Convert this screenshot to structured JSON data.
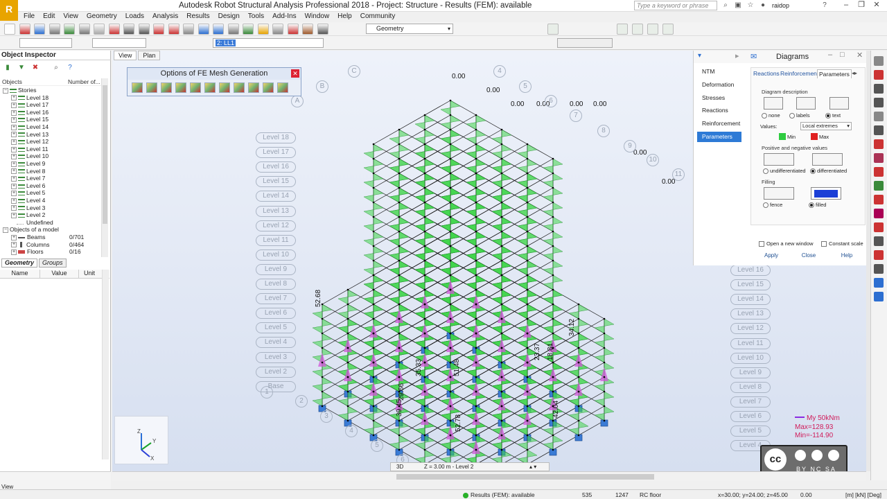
{
  "app": {
    "title": "Autodesk Robot Structural Analysis Professional 2018 - Project: Structure - Results (FEM): available",
    "logo_text": "R",
    "search_placeholder": "Type a keyword or phrase",
    "user": "raidop"
  },
  "menu": [
    "File",
    "Edit",
    "View",
    "Geometry",
    "Loads",
    "Analysis",
    "Results",
    "Design",
    "Tools",
    "Add-Ins",
    "Window",
    "Help",
    "Community"
  ],
  "toolbar": {
    "layout_select": "Geometry",
    "case_combo": "2: LL1"
  },
  "inspector": {
    "title": "Object Inspector",
    "col_objects": "Objects",
    "col_number": "Number of...",
    "root": "Stories",
    "levels": [
      "Level 18",
      "Level 17",
      "Level 16",
      "Level 15",
      "Level 14",
      "Level 13",
      "Level 12",
      "Level 11",
      "Level 10",
      "Level 9",
      "Level 8",
      "Level 7",
      "Level 6",
      "Level 5",
      "Level 4",
      "Level 3",
      "Level 2"
    ],
    "undefined": "Undefined",
    "objects_of_model": "Objects of a model",
    "beams": {
      "label": "Beams",
      "count": "0/701"
    },
    "columns": {
      "label": "Columns",
      "count": "0/464"
    },
    "floors": {
      "label": "Floors",
      "count": "0/16"
    },
    "tabs": [
      "Geometry",
      "Groups"
    ],
    "prop_cols": [
      "Name",
      "Value",
      "Unit"
    ]
  },
  "viewport": {
    "tabs": [
      "View",
      "Plan"
    ],
    "fe_panel_title": "Options of FE Mesh Generation",
    "left_levels": [
      "Level 18",
      "Level 17",
      "Level 16",
      "Level 15",
      "Level 14",
      "Level 13",
      "Level 12",
      "Level 11",
      "Level 10",
      "Level 9",
      "Level 8",
      "Level 7",
      "Level 6",
      "Level 5",
      "Level 4",
      "Level 3",
      "Level 2",
      "Base"
    ],
    "right_levels": [
      "Level 16",
      "Level 15",
      "Level 14",
      "Level 13",
      "Level 12",
      "Level 11",
      "Level 10",
      "Level 9",
      "Level 8",
      "Level 7",
      "Level 6",
      "Level 5",
      "Level 4"
    ],
    "grid_letters": [
      "A",
      "B",
      "C"
    ],
    "grid_numbers": [
      "1",
      "2",
      "3",
      "4",
      "5",
      "6"
    ],
    "grid_numbers_right": [
      "4",
      "5",
      "6",
      "7",
      "8",
      "9",
      "10",
      "11"
    ],
    "view_mode": "3D",
    "view_z": "Z = 3.00 m - Level 2",
    "legend": {
      "title": "My  50kNm",
      "max": "Max=128.93",
      "min": "Min=-114.90"
    },
    "cc_text": "BY NC SA",
    "values_top": [
      "0.00",
      "0.00",
      "0.00",
      "0.00",
      "0.00",
      "0.00",
      "0.00",
      "0.00"
    ],
    "values_side": [
      "52.68",
      "23.37",
      "18.81",
      "34.12",
      "35.33",
      "51.48",
      "52.78",
      "42.04",
      "29.66",
      "39.45"
    ]
  },
  "diagrams": {
    "title": "Diagrams",
    "categories": [
      "NTM",
      "Deformation",
      "Stresses",
      "Reactions",
      "Reinforcement",
      "Parameters"
    ],
    "active_category": "Parameters",
    "tabs": [
      "Reactions",
      "Reinforcement",
      "Parameters"
    ],
    "diagram_description": "Diagram description",
    "desc_options": [
      "none",
      "labels",
      "text"
    ],
    "values_label": "Values:",
    "values_select": "Local extremes",
    "min_label": "Min",
    "max_label": "Max",
    "pos_neg_title": "Positive and negative values",
    "pos_neg_options": [
      "undifferentiated",
      "differentiated"
    ],
    "filling_title": "Filling",
    "filling_options": [
      "fence",
      "filled"
    ],
    "open_new_window": "Open a new window",
    "constant_scale": "Constant scale",
    "buttons": {
      "apply": "Apply",
      "close": "Close",
      "help": "Help"
    },
    "colors": {
      "min": "#2ecc40",
      "max": "#e02020",
      "active": "#2d7ad6"
    }
  },
  "status": {
    "results": "Results (FEM): available",
    "num1": "535",
    "num2": "1247",
    "floor": "RC floor",
    "coords": "x=30.00; y=24.00; z=45.00",
    "value": "0.00",
    "units": "[m] [kN] [Deg]",
    "left_label": "View"
  }
}
